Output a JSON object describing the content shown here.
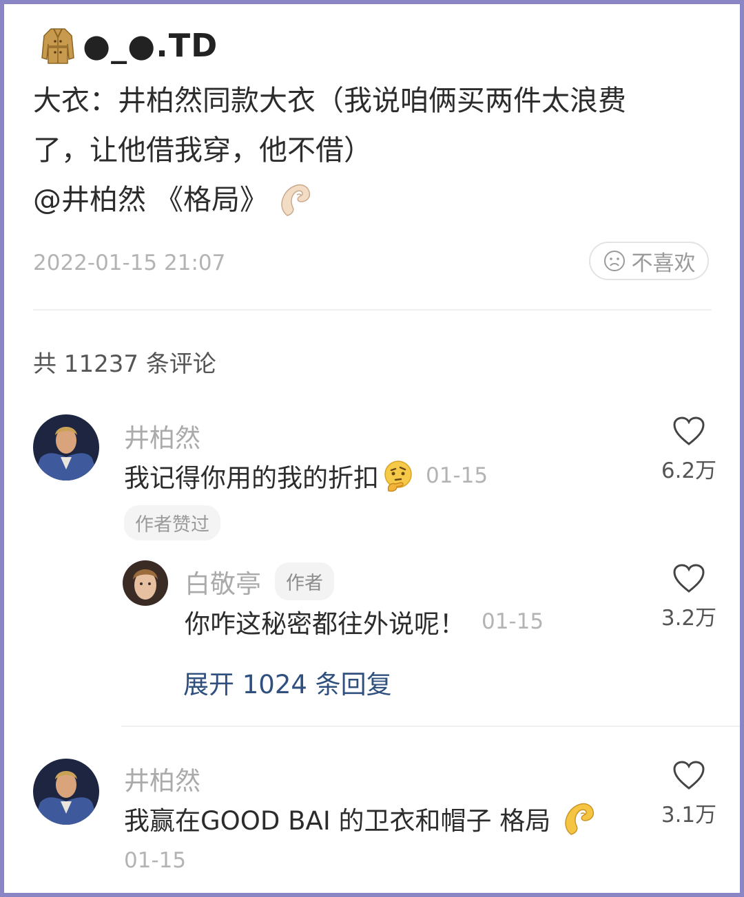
{
  "post": {
    "username": "●_●.TD",
    "coat_icon": "trench-coat-icon",
    "body_line1": "大衣：井柏然同款大衣（我说咱俩买两件太浪费",
    "body_line2": "了，让他借我穿，他不借）",
    "body_line3": "@井柏然 《格局》",
    "time": "2022-01-15 21:07",
    "dislike_label": "不喜欢"
  },
  "comments_header": "共 11237 条评论",
  "comments": [
    {
      "author": "井柏然",
      "text": "我记得你用的我的折扣",
      "date": "01-15",
      "likes": "6.2万",
      "chip": "作者赞过",
      "reply": {
        "author": "白敬亭",
        "tag": "作者",
        "text": "你咋这秘密都往外说呢！",
        "date": "01-15",
        "likes": "3.2万"
      },
      "expand": "展开 1024 条回复"
    },
    {
      "author": "井柏然",
      "text": "我赢在GOOD BAI 的卫衣和帽子 格局",
      "date": "01-15",
      "likes": "3.1万"
    }
  ],
  "colors": {
    "frame": "#8a86c6",
    "link": "#2f4f7e",
    "muted": "#b3b3b3"
  }
}
